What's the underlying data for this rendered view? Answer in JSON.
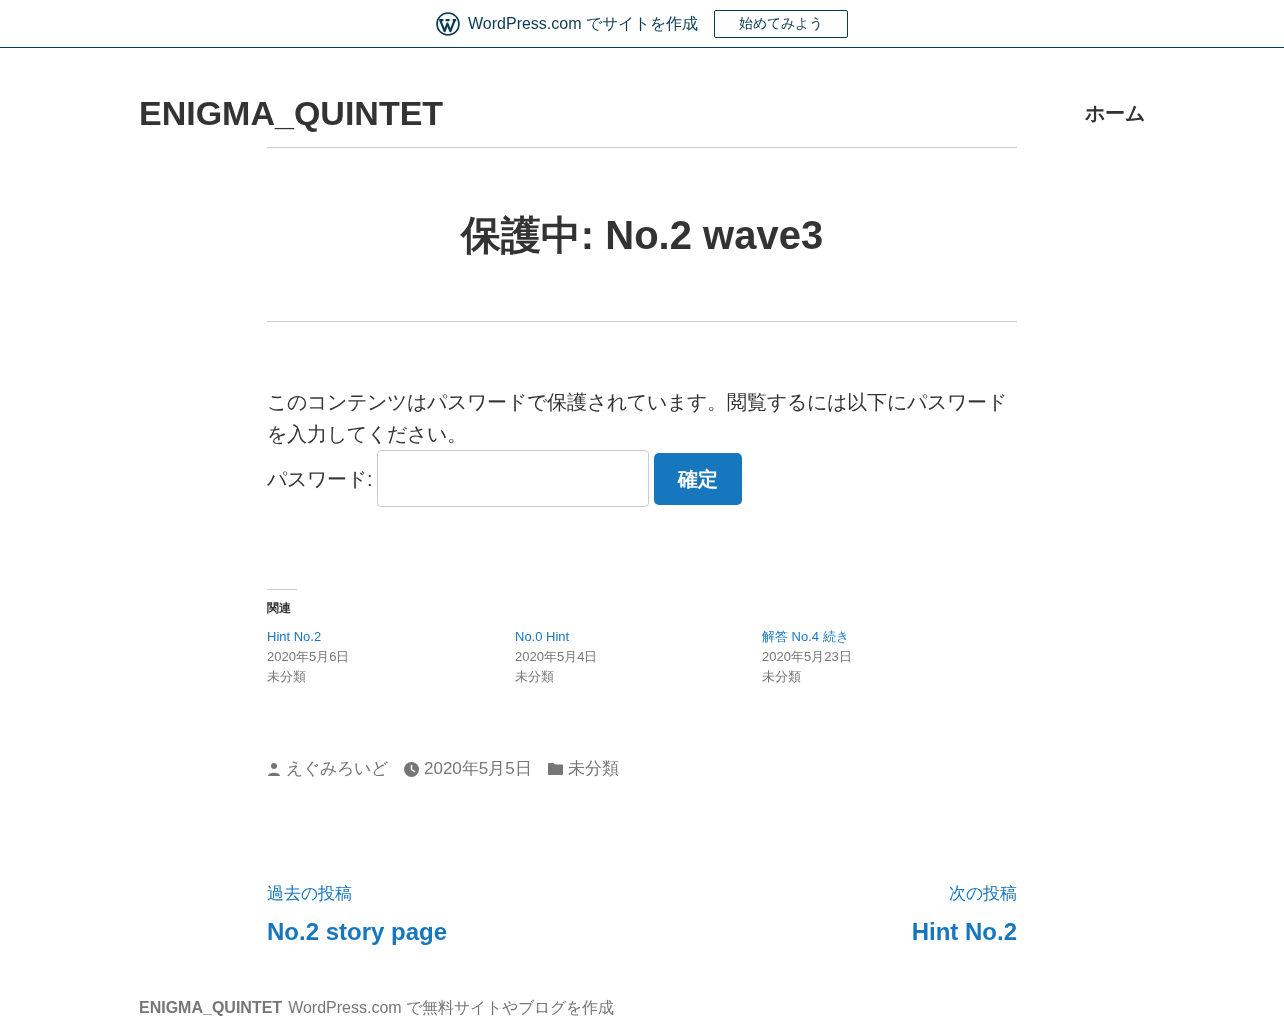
{
  "promo_bar": {
    "text": "WordPress.com でサイトを作成",
    "button": "始めてみよう"
  },
  "header": {
    "site_title": "ENIGMA_QUINTET",
    "nav": [
      {
        "label": "ホーム"
      }
    ]
  },
  "post": {
    "title": "保護中: No.2 wave3",
    "message": "このコンテンツはパスワードで保護されています。閲覧するには以下にパスワードを入力してください。",
    "password": {
      "label": "パスワード:",
      "submit": "確定"
    }
  },
  "related": {
    "heading": "関連",
    "items": [
      {
        "title": "Hint No.2",
        "date": "2020年5月6日",
        "category": "未分類"
      },
      {
        "title": "No.0 Hint",
        "date": "2020年5月4日",
        "category": "未分類"
      },
      {
        "title": "解答 No.4 続き",
        "date": "2020年5月23日",
        "category": "未分類"
      }
    ]
  },
  "meta": [
    {
      "kind": "author",
      "text": "えぐみろいど"
    },
    {
      "kind": "date",
      "text": "2020年5月5日"
    },
    {
      "kind": "category",
      "text": "未分類"
    }
  ],
  "post_nav": [
    {
      "kind": "previous",
      "caption": "過去の投稿",
      "title": "No.2 story page"
    },
    {
      "kind": "next",
      "caption": "次の投稿",
      "title": "Hint No.2"
    }
  ],
  "footer": {
    "site_title": "ENIGMA_QUINTET",
    "credit": "WordPress.com で無料サイトやブログを作成"
  }
}
